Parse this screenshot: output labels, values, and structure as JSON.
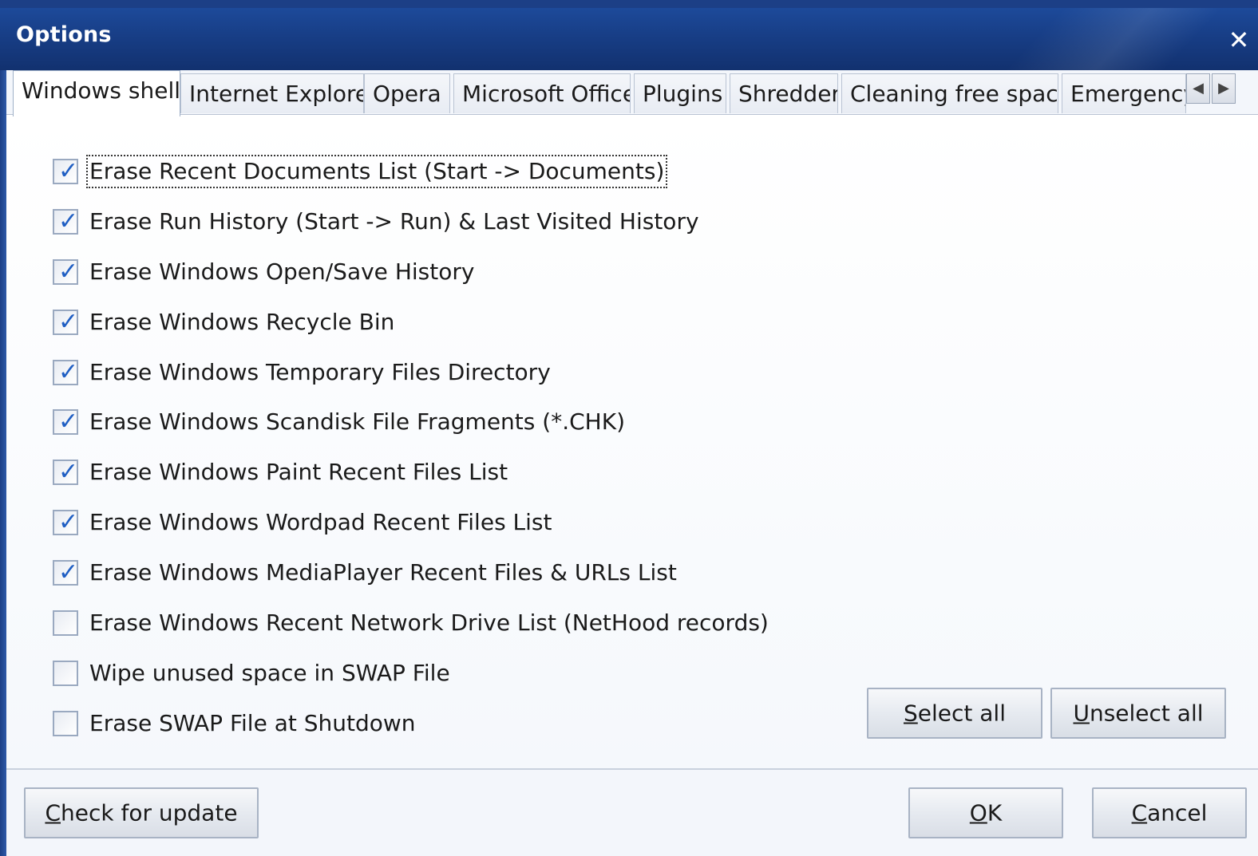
{
  "window": {
    "title": "Options",
    "close_glyph": "✕"
  },
  "tabs": {
    "items": [
      {
        "label": "Windows shell",
        "active": true
      },
      {
        "label": "Internet Explorer",
        "active": false
      },
      {
        "label": "Opera",
        "active": false
      },
      {
        "label": "Microsoft Office",
        "active": false
      },
      {
        "label": "Plugins",
        "active": false
      },
      {
        "label": "Shredder",
        "active": false
      },
      {
        "label": "Cleaning free space",
        "active": false
      },
      {
        "label": "Emergency",
        "active": false
      }
    ],
    "scroll_left_glyph": "◀",
    "scroll_right_glyph": "▶"
  },
  "options": [
    {
      "label": "Erase Recent Documents List (Start -> Documents)",
      "checked": true
    },
    {
      "label": "Erase Run History (Start -> Run) & Last Visited History",
      "checked": true
    },
    {
      "label": "Erase Windows Open/Save History",
      "checked": true
    },
    {
      "label": "Erase Windows Recycle Bin",
      "checked": true
    },
    {
      "label": "Erase Windows Temporary Files Directory",
      "checked": true
    },
    {
      "label": "Erase Windows Scandisk File Fragments (*.CHK)",
      "checked": true
    },
    {
      "label": "Erase Windows Paint Recent Files List",
      "checked": true
    },
    {
      "label": "Erase Windows Wordpad Recent Files List",
      "checked": true
    },
    {
      "label": "Erase Windows MediaPlayer Recent Files & URLs List",
      "checked": true
    },
    {
      "label": "Erase Windows Recent Network Drive List (NetHood records)",
      "checked": false
    },
    {
      "label": "Wipe unused space in SWAP File",
      "checked": false
    },
    {
      "label": "Erase SWAP File at Shutdown",
      "checked": false
    }
  ],
  "checkmark_glyph": "✓",
  "buttons": {
    "select_all": {
      "access_key": "S",
      "rest": "elect all"
    },
    "unselect_all": {
      "access_key": "U",
      "rest": "nselect all"
    },
    "check_update": {
      "access_key": "C",
      "rest": "heck for update"
    },
    "ok": {
      "access_key": "O",
      "rest": "K"
    },
    "cancel": {
      "access_key": "C",
      "rest": "ancel"
    }
  },
  "colors": {
    "titlebar": "#183f88",
    "check_accent": "#1f5ec3"
  }
}
